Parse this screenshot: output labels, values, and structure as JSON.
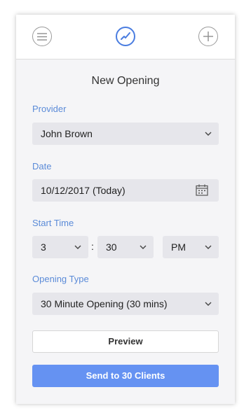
{
  "header": {
    "menu_icon": "hamburger-menu-icon",
    "center_icon": "activity-chart-icon",
    "add_icon": "plus-icon"
  },
  "page": {
    "title": "New Opening"
  },
  "form": {
    "provider": {
      "label": "Provider",
      "value": "John Brown"
    },
    "date": {
      "label": "Date",
      "value": "10/12/2017 (Today)"
    },
    "start_time": {
      "label": "Start Time",
      "hour": "3",
      "separator": ":",
      "minute": "30",
      "meridiem": "PM"
    },
    "opening_type": {
      "label": "Opening Type",
      "value": "30 Minute Opening (30 mins)"
    }
  },
  "actions": {
    "preview_label": "Preview",
    "send_label": "Send to 30 Clients"
  },
  "colors": {
    "accent": "#4a7de0",
    "label": "#5b8bd8",
    "primary_button": "#6592f2",
    "field_bg": "#e6e6eb",
    "panel_bg": "#f5f5f7"
  }
}
